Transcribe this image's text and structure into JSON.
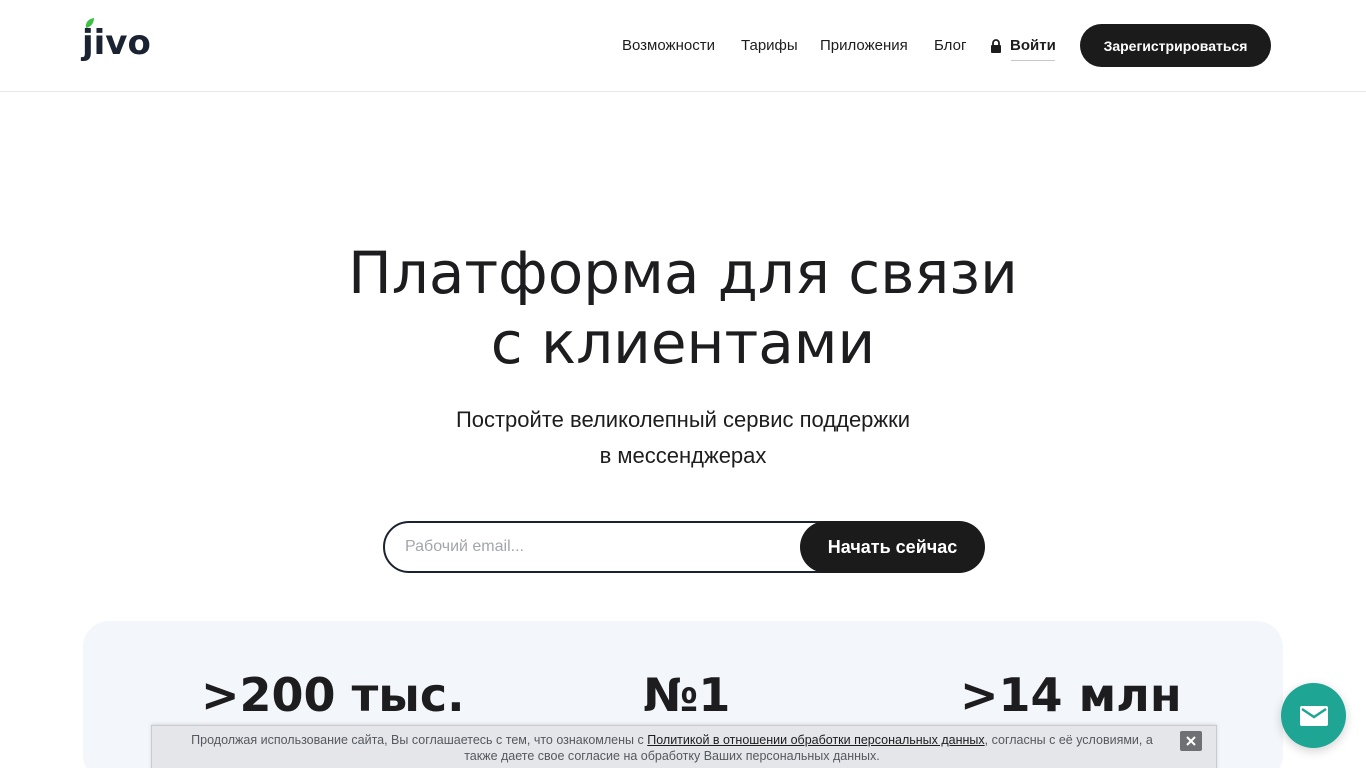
{
  "brand": {
    "logo_text": "jivo",
    "leaf_color": "#3cc143",
    "logo_color": "#1b2333"
  },
  "nav": {
    "items": [
      {
        "label": "Возможности"
      },
      {
        "label": "Тарифы"
      },
      {
        "label": "Приложения"
      },
      {
        "label": "Блог"
      }
    ],
    "login_label": "Войти",
    "login_icon": "lock-icon",
    "register_label": "Зарегистрироваться"
  },
  "hero": {
    "title_line1": "Платформа для связи",
    "title_line2": "с клиентами",
    "subtitle_line1": "Постройте великолепный сервис поддержки",
    "subtitle_line2": "в мессенджерах",
    "email_placeholder": "Рабочий email...",
    "email_value": "",
    "cta_label": "Начать сейчас"
  },
  "stats": [
    {
      "value": ">200 тыс."
    },
    {
      "value": "№1"
    },
    {
      "value": ">14 млн"
    }
  ],
  "cookie": {
    "text_before": "Продолжая использование сайта, Вы соглашаетесь с тем, что ознакомлены с ",
    "link_text": "Политикой в отношении обработки персональных данных",
    "text_after": ", согласны с её условиями, а также даете свое согласие на обработку Ваших персональных данных.",
    "close_icon": "close-icon"
  },
  "chat_widget": {
    "icon": "mail-icon",
    "color": "#1ea594"
  }
}
